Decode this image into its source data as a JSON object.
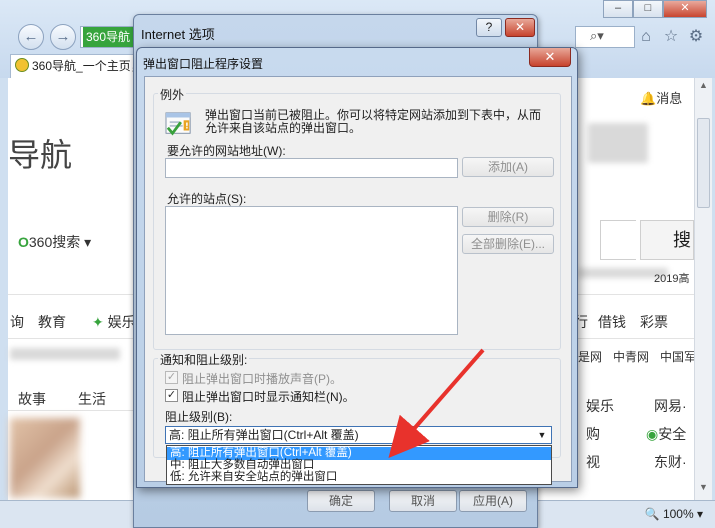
{
  "browser": {
    "address_tag": "360导航",
    "tab_title": "360导航_一个主页，整个世界",
    "zoom": "100%",
    "notification_label": "消息",
    "page": {
      "brand": "导航",
      "search_logo": "360搜索",
      "search_button": "搜",
      "year_text": "2019高",
      "nav_left": [
        "询",
        "教育",
        "娱乐"
      ],
      "nav_right": [
        "行",
        "借钱",
        "彩票"
      ],
      "links_right": [
        "是网",
        "中青网",
        "中国军"
      ],
      "section_tabs": [
        "故事",
        "生活"
      ],
      "side_items": [
        "娱乐",
        "网易·",
        "购",
        "安全",
        "视",
        "东财·"
      ]
    }
  },
  "outer_dialog": {
    "title": "Internet 选项",
    "help": "?",
    "bottom_buttons": [
      "确定",
      "取消",
      "应用(A)"
    ]
  },
  "popup_dialog": {
    "title": "弹出窗口阻止程序设置",
    "close": "✕",
    "exceptions": {
      "group_label": "例外",
      "description_line1": "弹出窗口当前已被阻止。你可以将特定网站添加到下表中，从而",
      "description_line2": "允许来自该站点的弹出窗口。",
      "address_label": "要允许的网站地址(W):",
      "address_value": "",
      "add_button": "添加(A)",
      "allowed_label": "允许的站点(S):",
      "allowed_sites": [],
      "remove_button": "删除(R)",
      "remove_all_button": "全部删除(E)..."
    },
    "notifications": {
      "group_label": "通知和阻止级别:",
      "play_sound": {
        "label": "阻止弹出窗口时播放声音(P)。",
        "checked": true,
        "enabled": false
      },
      "show_bar": {
        "label": "阻止弹出窗口时显示通知栏(N)。",
        "checked": true,
        "enabled": true
      },
      "level_label": "阻止级别(B):",
      "level_selected": "高: 阻止所有弹出窗口(Ctrl+Alt 覆盖)",
      "level_options": [
        "高: 阻止所有弹出窗口(Ctrl+Alt 覆盖)",
        "中: 阻止大多数自动弹出窗口",
        "低: 允许来自安全站点的弹出窗口"
      ]
    }
  },
  "colors": {
    "selection": "#3399ff",
    "annotation_arrow": "#e8322c",
    "close_button": "#c7432d"
  }
}
